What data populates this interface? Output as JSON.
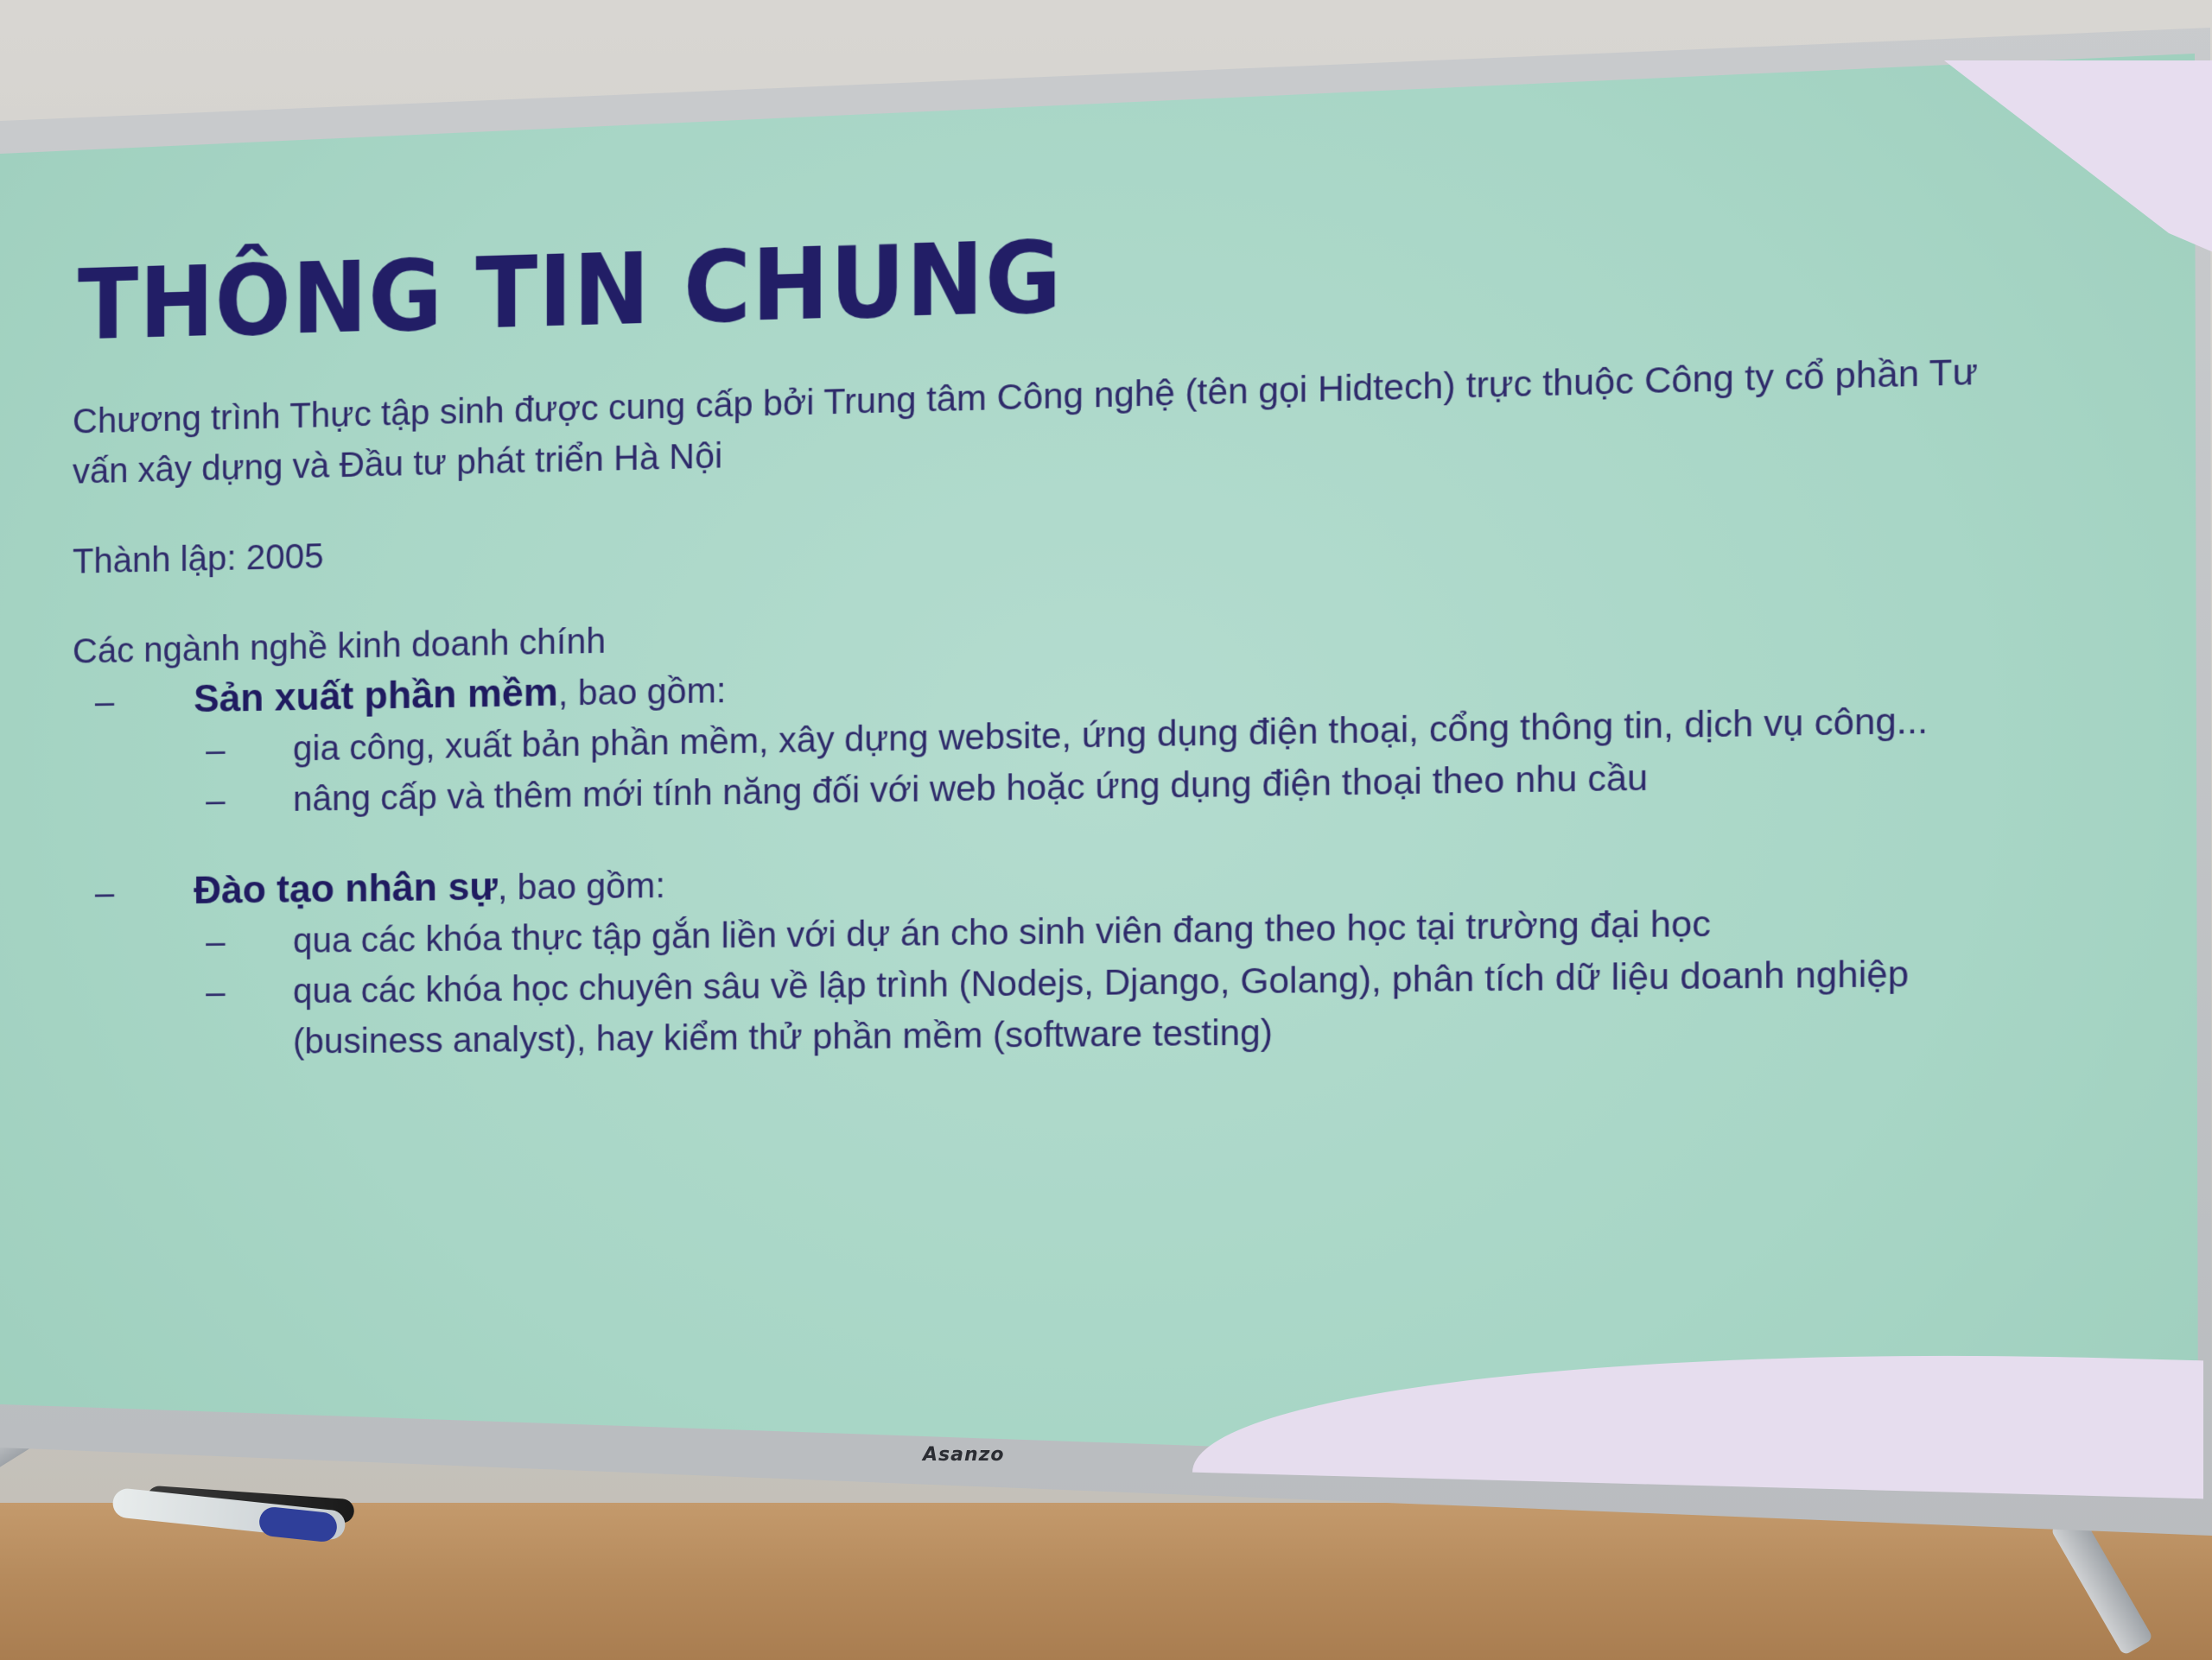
{
  "slide": {
    "title": "THÔNG TIN CHUNG",
    "intro_line1": "Chương trình Thực tập sinh được cung cấp bởi Trung tâm Công nghệ (tên gọi Hidtech) trực thuộc Công ty cổ phần Tư",
    "intro_line2": "vấn xây dựng và Đầu tư phát triển Hà Nội",
    "founded": "Thành lập: 2005",
    "business_heading": "Các ngành nghề kinh doanh chính",
    "dash": "–",
    "sections": [
      {
        "title": "Sản xuất phần mềm",
        "suffix": ", bao gồm:",
        "items": [
          "gia công, xuất bản phần mềm, xây dựng website, ứng dụng điện thoại, cổng thông tin, dịch vụ công...",
          "nâng cấp và thêm mới tính năng đối với web hoặc ứng dụng điện thoại theo nhu cầu"
        ]
      },
      {
        "title": "Đào tạo nhân sự",
        "suffix": ", bao gồm:",
        "items": [
          "qua các khóa thực tập gắn liền với dự án cho sinh viên đang theo học tại trường đại học",
          "qua các khóa học chuyên sâu về lập trình (Nodejs, Django, Golang), phân tích dữ liệu doanh nghiệp"
        ],
        "item2_continuation": "(business analyst), hay kiểm thử phần mềm (software testing)"
      }
    ]
  },
  "tv": {
    "brand": "Asanzo"
  },
  "colors": {
    "slide_background": "#a8d6c6",
    "text": "#2e2a6a",
    "title": "#221e66",
    "accent_blob": "#e6ddee"
  }
}
